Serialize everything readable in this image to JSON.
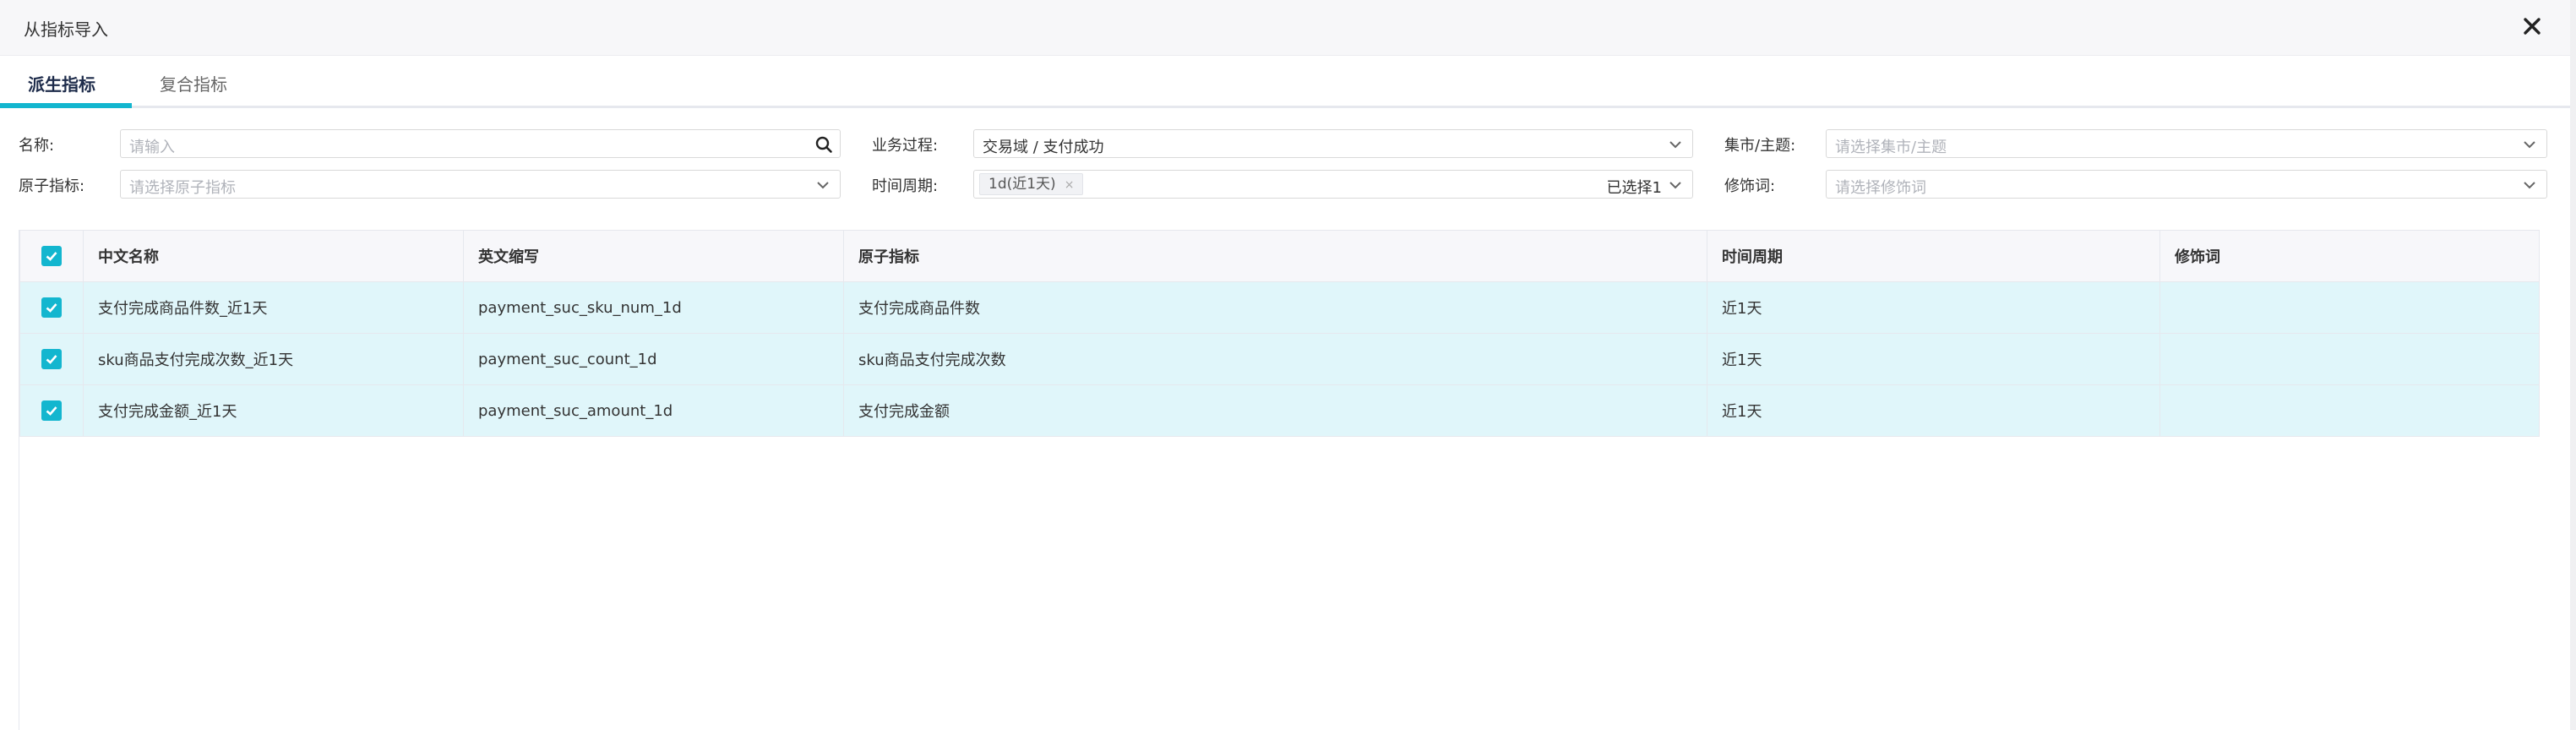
{
  "dialog": {
    "title": "从指标导入",
    "close_icon": "close-icon"
  },
  "tabs": [
    {
      "label": "派生指标",
      "active": true
    },
    {
      "label": "复合指标",
      "active": false
    }
  ],
  "filters": {
    "name": {
      "label": "名称:",
      "placeholder": "请输入",
      "icon": "search-icon"
    },
    "business_process": {
      "label": "业务过程:",
      "value": "交易域 / 支付成功"
    },
    "mart_subject": {
      "label": "集市/主题:",
      "placeholder": "请选择集市/主题"
    },
    "atomic_metric": {
      "label": "原子指标:",
      "placeholder": "请选择原子指标"
    },
    "time_period": {
      "label": "时间周期:",
      "tag": "1d(近1天)",
      "tag_remove": "×",
      "selected_count": "已选择1"
    },
    "modifier": {
      "label": "修饰词:",
      "placeholder": "请选择修饰词"
    }
  },
  "table": {
    "header_checked": true,
    "columns": [
      "中文名称",
      "英文缩写",
      "原子指标",
      "时间周期",
      "修饰词"
    ],
    "rows": [
      {
        "checked": true,
        "cn_name": "支付完成商品件数_近1天",
        "en_abbr": "payment_suc_sku_num_1d",
        "atomic": "支付完成商品件数",
        "period": "近1天",
        "modifier": ""
      },
      {
        "checked": true,
        "cn_name": "sku商品支付完成次数_近1天",
        "en_abbr": "payment_suc_count_1d",
        "atomic": "sku商品支付完成次数",
        "period": "近1天",
        "modifier": ""
      },
      {
        "checked": true,
        "cn_name": "支付完成金额_近1天",
        "en_abbr": "payment_suc_amount_1d",
        "atomic": "支付完成金额",
        "period": "近1天",
        "modifier": ""
      }
    ]
  },
  "colors": {
    "accent": "#13b6cf",
    "row_selected_bg": "#e0f6fa",
    "header_bg": "#f7f7fa"
  }
}
